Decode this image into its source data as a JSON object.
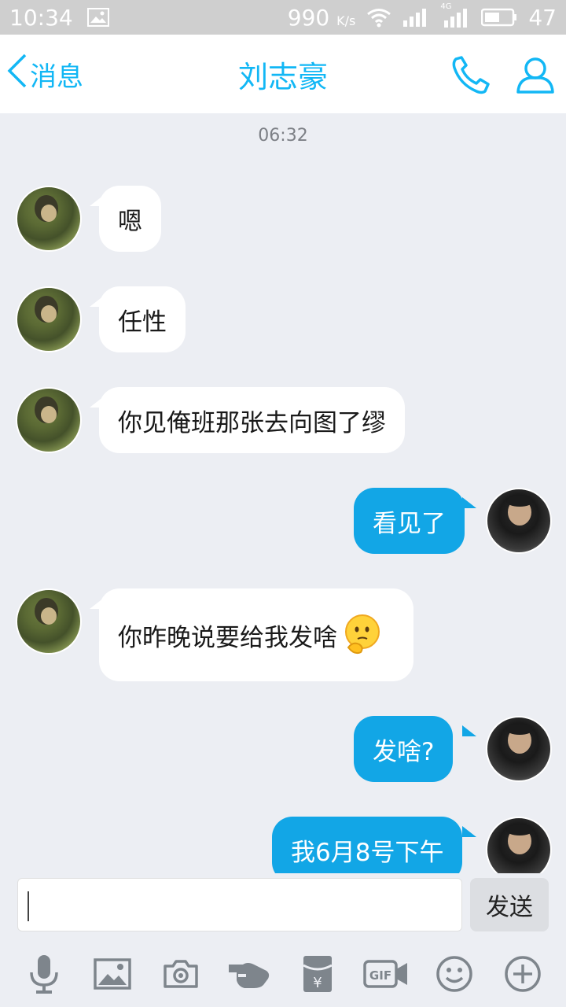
{
  "status_bar": {
    "time": "10:34",
    "speed": "990",
    "speed_unit": "K/s",
    "network": "4G",
    "battery": "47",
    "icons": [
      "image-icon",
      "wifi-icon",
      "signal-icon",
      "signal-4g-icon",
      "battery-icon"
    ]
  },
  "header": {
    "back_label": "消息",
    "title": "刘志豪",
    "icons": [
      "back-chevron-icon",
      "phone-icon",
      "profile-icon"
    ],
    "accent": "#12b7f5"
  },
  "chat": {
    "timestamp": "06:32",
    "messages": [
      {
        "from": "friend",
        "text": "嗯"
      },
      {
        "from": "friend",
        "text": "任性"
      },
      {
        "from": "friend",
        "text": "你见俺班那张去向图了缪"
      },
      {
        "from": "me",
        "text": "看见了"
      },
      {
        "from": "friend",
        "text": "你昨晚说要给我发啥",
        "emoji": "thinking-face-emoji"
      },
      {
        "from": "me",
        "text": "发啥?"
      },
      {
        "from": "me",
        "text": "我6月8号下午"
      }
    ],
    "bubble_colors": {
      "incoming": "#ffffff",
      "outgoing": "#12a6e6"
    }
  },
  "composer": {
    "input_value": "",
    "send_label": "发送"
  },
  "toolbar": {
    "icons": [
      "microphone-icon",
      "picture-icon",
      "camera-icon",
      "poke-hand-icon",
      "red-packet-icon",
      "gif-icon",
      "emoji-icon",
      "plus-icon"
    ]
  }
}
